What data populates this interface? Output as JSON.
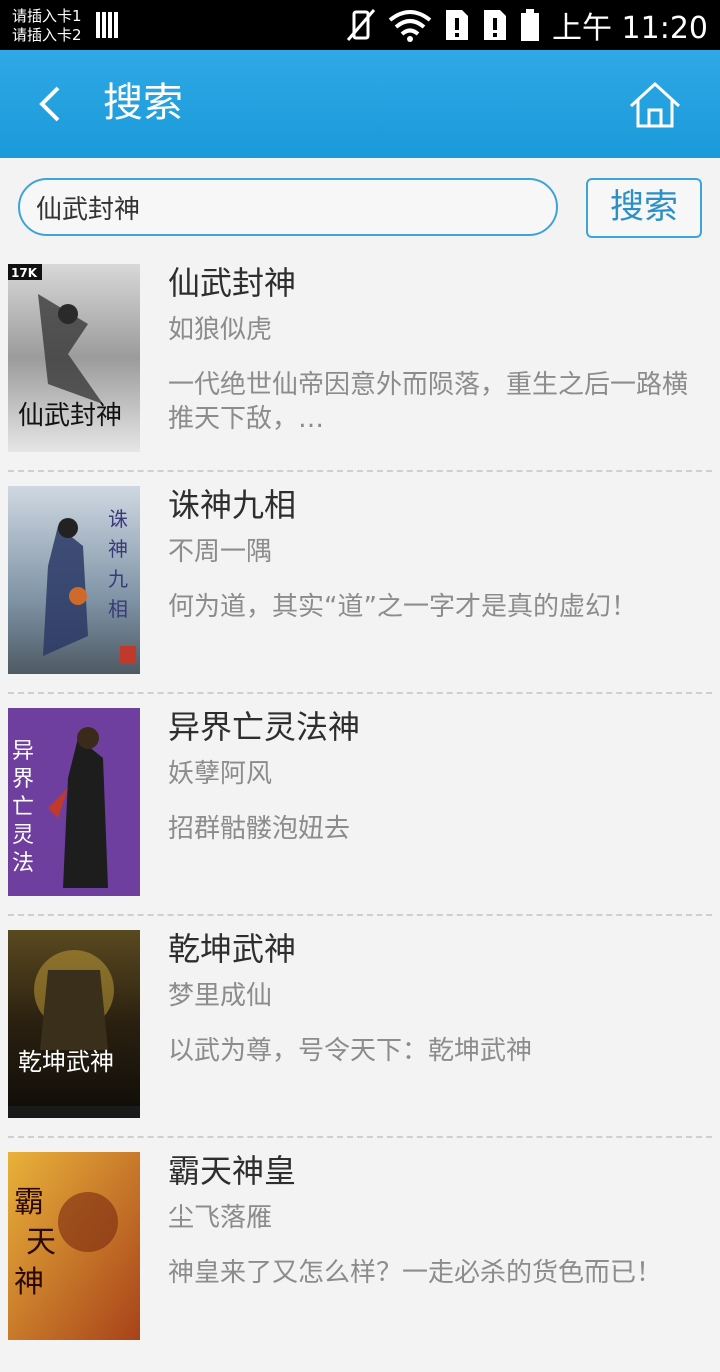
{
  "status_bar": {
    "sim1": "请插入卡1",
    "sim2": "请插入卡2",
    "time": "上午 11:20"
  },
  "header": {
    "title": "搜索",
    "back_icon": "chevron-left-icon",
    "home_icon": "home-icon"
  },
  "search": {
    "value": "仙武封神",
    "placeholder": "仙武封神",
    "button_label": "搜索"
  },
  "colors": {
    "header": "#1a9ad9",
    "accent_border": "#3ea3d8"
  },
  "books": [
    {
      "title": "仙武封神",
      "author": "如狼似虎",
      "desc": "一代绝世仙帝因意外而陨落，重生之后一路横推天下敌，…",
      "cover_logo": "17K",
      "cover_title": "仙武封神"
    },
    {
      "title": "诛神九相",
      "author": "不周一隅",
      "desc": "何为道，其实“道”之一字才是真的虚幻！",
      "cover_title": "诛神九相"
    },
    {
      "title": "异界亡灵法神",
      "author": "妖孽阿风",
      "desc": "招群骷髅泡妞去",
      "cover_title": "异界亡灵法神"
    },
    {
      "title": "乾坤武神",
      "author": "梦里成仙",
      "desc": "以武为尊，号令天下：乾坤武神",
      "cover_title": "乾坤武神"
    },
    {
      "title": "霸天神皇",
      "author": "尘飞落雁",
      "desc": "神皇来了又怎么样？一走必杀的货色而已！",
      "cover_title": "霸天神皇"
    }
  ]
}
